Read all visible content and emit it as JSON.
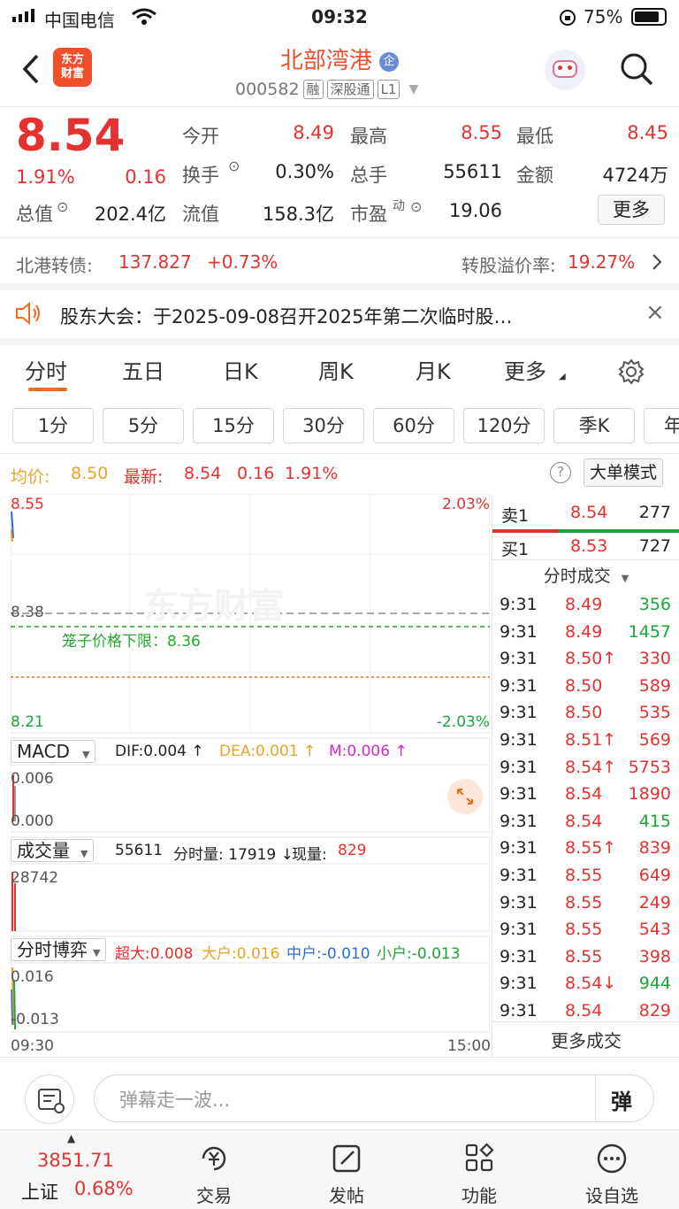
{
  "status": {
    "carrier": "中国电信",
    "time": "09:32",
    "battery": "75%"
  },
  "header": {
    "logo_line1": "东方",
    "logo_line2": "财富",
    "title": "北部湾港",
    "badge": "企",
    "code": "000582",
    "tag_rong": "融",
    "tag_shen": "深股通",
    "tag_l1": "L1"
  },
  "quote": {
    "price": "8.54",
    "change_pct": "1.91%",
    "change": "0.16",
    "open_label": "今开",
    "open": "8.49",
    "high_label": "最高",
    "high": "8.55",
    "low_label": "最低",
    "low": "8.45",
    "turnover_label": "换手",
    "turnover": "0.30%",
    "volume_label": "总手",
    "volume": "55611",
    "amount_label": "金额",
    "amount": "4724万",
    "mktcap_label": "总值",
    "mktcap": "202.4亿",
    "float_label": "流值",
    "float": "158.3亿",
    "pe_label": "市盈",
    "pe_sup": "动",
    "pe": "19.06",
    "more_button": "更多"
  },
  "bond": {
    "label": "北港转债:",
    "price": "137.827",
    "change": "+0.73%",
    "premium_label": "转股溢价率:",
    "premium": "19.27%"
  },
  "notice": {
    "text": "股东大会：于2025-09-08召开2025年第二次临时股…"
  },
  "tabs": [
    "分时",
    "五日",
    "日K",
    "周K",
    "月K",
    "更多"
  ],
  "periods": [
    "1分",
    "5分",
    "15分",
    "30分",
    "60分",
    "120分",
    "季K",
    "年"
  ],
  "info": {
    "avg_label": "均价:",
    "avg": "8.50",
    "latest_label": "最新:",
    "latest": "8.54",
    "chg": "0.16",
    "pct": "1.91%",
    "mode_button": "大单模式"
  },
  "chart_labels": {
    "y_top": "8.55",
    "y_mid": "8.38",
    "y_bottom": "8.21",
    "pct_top": "2.03%",
    "pct_bottom": "-2.03%",
    "cage_label": "笼子价格下限：8.36",
    "watermark": "东方财富",
    "x_start": "09:30",
    "x_end": "15:00"
  },
  "macd": {
    "name": "MACD",
    "dif": "DIF:0.004 ↑",
    "dea": "DEA:0.001 ↑",
    "m": "M:0.006 ↑",
    "top": "0.006",
    "bottom": "0.000"
  },
  "vol": {
    "name": "成交量",
    "total": "55611",
    "period": "分时量: 17919 ↓",
    "now_label": "现量:",
    "now": "829",
    "top": "28742"
  },
  "game": {
    "name": "分时博弈",
    "super": "超大:0.008",
    "big": "大户:0.016",
    "mid": "中户:-0.010",
    "small": "小户:-0.013",
    "top": "0.016",
    "bottom": "-0.013"
  },
  "orderbook": {
    "sell_label": "卖1",
    "sell_price": "8.54",
    "sell_vol": "277",
    "buy_label": "买1",
    "buy_price": "8.53",
    "buy_vol": "727"
  },
  "trades_title": "分时成交",
  "trades": [
    {
      "t": "9:31",
      "p": "8.49",
      "v": "356",
      "vc": "green"
    },
    {
      "t": "9:31",
      "p": "8.49",
      "v": "1457",
      "vc": "green"
    },
    {
      "t": "9:31",
      "p": "8.50↑",
      "v": "330",
      "vc": "red"
    },
    {
      "t": "9:31",
      "p": "8.50",
      "v": "589",
      "vc": "red"
    },
    {
      "t": "9:31",
      "p": "8.50",
      "v": "535",
      "vc": "red"
    },
    {
      "t": "9:31",
      "p": "8.51↑",
      "v": "569",
      "vc": "red"
    },
    {
      "t": "9:31",
      "p": "8.54↑",
      "v": "5753",
      "vc": "red"
    },
    {
      "t": "9:31",
      "p": "8.54",
      "v": "1890",
      "vc": "red"
    },
    {
      "t": "9:31",
      "p": "8.54",
      "v": "415",
      "vc": "green"
    },
    {
      "t": "9:31",
      "p": "8.55↑",
      "v": "839",
      "vc": "red"
    },
    {
      "t": "9:31",
      "p": "8.55",
      "v": "649",
      "vc": "red"
    },
    {
      "t": "9:31",
      "p": "8.55",
      "v": "249",
      "vc": "red"
    },
    {
      "t": "9:31",
      "p": "8.55",
      "v": "543",
      "vc": "red"
    },
    {
      "t": "9:31",
      "p": "8.55",
      "v": "398",
      "vc": "red"
    },
    {
      "t": "9:31",
      "p": "8.54↓",
      "v": "944",
      "vc": "green"
    },
    {
      "t": "9:31",
      "p": "8.54",
      "v": "829",
      "vc": "red"
    }
  ],
  "more_trades": "更多成交",
  "danmu": {
    "placeholder": "弹幕走一波...",
    "send_label": "弹"
  },
  "bottom": {
    "index_value": "3851.71",
    "index_name": "上证",
    "index_pct": "0.68%",
    "trade": "交易",
    "post": "发帖",
    "func": "功能",
    "fav": "设自选"
  }
}
